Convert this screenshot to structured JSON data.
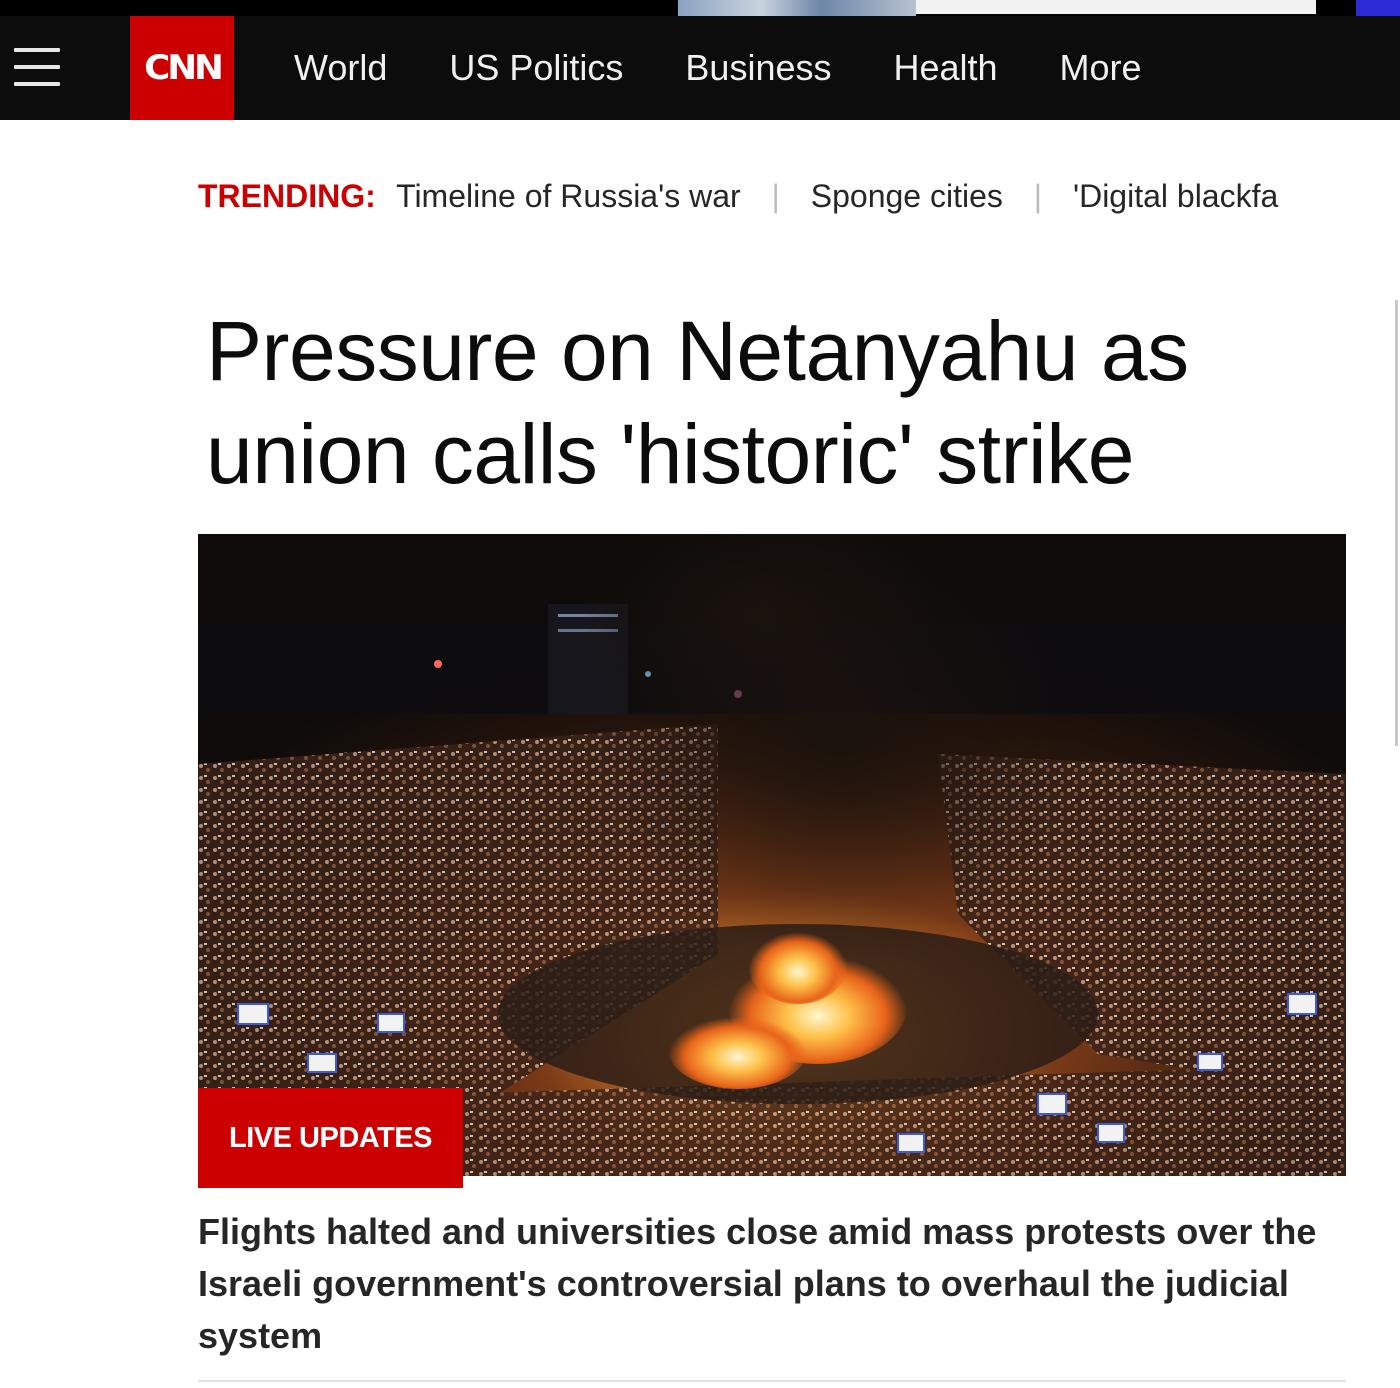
{
  "nav": {
    "logo": "CNN",
    "items": [
      {
        "label": "World"
      },
      {
        "label": "US Politics"
      },
      {
        "label": "Business"
      },
      {
        "label": "Health"
      },
      {
        "label": "More"
      }
    ]
  },
  "trending": {
    "label": "TRENDING:",
    "items": [
      {
        "label": "Timeline of Russia's war"
      },
      {
        "label": "Sponge cities"
      },
      {
        "label": "'Digital blackfa"
      }
    ]
  },
  "article": {
    "headline_line1": "Pressure on Netanyahu as",
    "headline_line2": "union calls 'historic' strike",
    "badge": "LIVE UPDATES",
    "summary": "Flights halted and universities close amid mass protests over the Israeli government's controversial plans to overhaul the judicial system"
  },
  "colors": {
    "brand_red": "#cc0000",
    "nav_background": "#0c0c0c"
  }
}
